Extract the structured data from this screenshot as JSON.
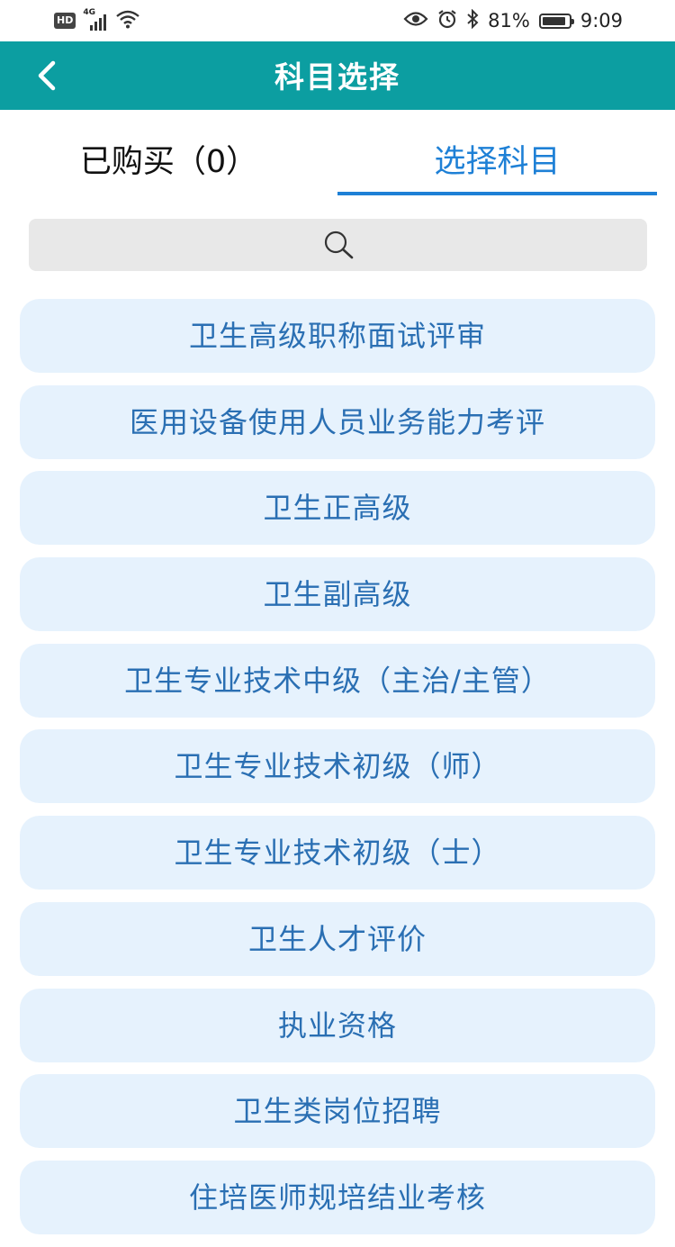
{
  "status_bar": {
    "hd": "HD",
    "network": "4G",
    "battery": "81%",
    "time": "9:09",
    "icons": [
      "hd-icon",
      "signal-icon",
      "wifi-icon",
      "eye-icon",
      "alarm-icon",
      "bluetooth-icon",
      "battery-icon"
    ]
  },
  "header": {
    "title": "科目选择",
    "back_icon": "chevron-left-icon",
    "background": "#0c9ea1"
  },
  "tabs": [
    {
      "label": "已购买（0）",
      "active": false
    },
    {
      "label": "选择科目",
      "active": true
    }
  ],
  "search": {
    "placeholder": "",
    "icon": "search-icon"
  },
  "subjects": [
    "卫生高级职称面试评审",
    "医用设备使用人员业务能力考评",
    "卫生正高级",
    "卫生副高级",
    "卫生专业技术中级（主治/主管）",
    "卫生专业技术初级（师）",
    "卫生专业技术初级（士）",
    "卫生人才评价",
    "执业资格",
    "卫生类岗位招聘",
    "住培医师规培结业考核"
  ],
  "colors": {
    "accent": "#1e80d6",
    "item_bg": "#e6f2fd",
    "item_text": "#2a6fb3"
  }
}
